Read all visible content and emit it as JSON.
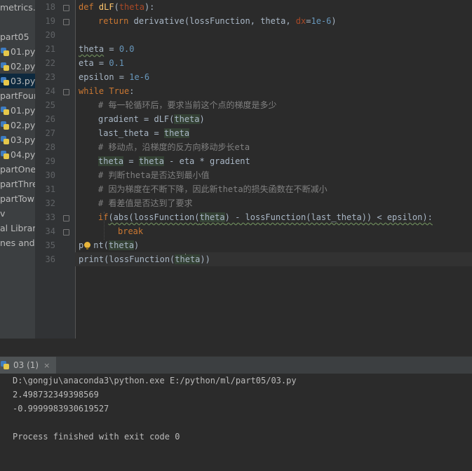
{
  "project_tree": {
    "items": [
      {
        "label": "metrics.p",
        "icon": "none"
      },
      {
        "label": "part05",
        "icon": "none"
      },
      {
        "label": "01.py",
        "icon": "python-file-icon"
      },
      {
        "label": "02.py",
        "icon": "python-file-icon"
      },
      {
        "label": "03.py",
        "icon": "python-file-icon",
        "selected": true
      },
      {
        "label": "partFour",
        "icon": "none"
      },
      {
        "label": "01.py",
        "icon": "python-file-icon"
      },
      {
        "label": "02.py",
        "icon": "python-file-icon"
      },
      {
        "label": "03.py",
        "icon": "python-file-icon"
      },
      {
        "label": "04.py",
        "icon": "python-file-icon"
      },
      {
        "label": "partOne",
        "icon": "none"
      },
      {
        "label": "partThree",
        "icon": "none"
      },
      {
        "label": "partTow",
        "icon": "none"
      },
      {
        "label": "v",
        "icon": "none"
      },
      {
        "label": "al Librari",
        "icon": "none"
      },
      {
        "label": "nes and C",
        "icon": "none"
      }
    ]
  },
  "editor": {
    "line_numbers": [
      "18",
      "19",
      "20",
      "21",
      "22",
      "23",
      "24",
      "25",
      "26",
      "27",
      "28",
      "29",
      "30",
      "31",
      "32",
      "33",
      "34",
      "35",
      "36"
    ],
    "current_line": "36",
    "code": {
      "l18": "def dLF(theta):",
      "l19_ret": "return",
      "l19_call": "derivative(lossFunction, theta, ",
      "l19_dx": "dx",
      "l19_eq": "=",
      "l19_val": "1e-6",
      "l19_end": ")",
      "l21_var": "theta",
      "l21_rest": " = ",
      "l21_val": "0.0",
      "l22_var": "eta = ",
      "l22_val": "0.1",
      "l23_var": "epsilon = ",
      "l23_val": "1e-6",
      "l24_kw": "while",
      "l24_true": "True",
      "l24_colon": ":",
      "l25": "# 每一轮循环后，要求当前这个点的梯度是多少",
      "l26_a": "gradient = dLF(",
      "l26_b": "theta",
      "l26_c": ")",
      "l27_a": "last_theta = ",
      "l27_b": "theta",
      "l28": "# 移动点，沿梯度的反方向移动步长eta",
      "l29_a": "theta",
      "l29_b": " = ",
      "l29_c": "theta",
      "l29_d": " - eta * gradient",
      "l30": "# 判断theta是否达到最小值",
      "l31": "# 因为梯度在不断下降，因此新theta的损失函数在不断减小",
      "l32": "# 看差值是否达到了要求",
      "l33_if": "if",
      "l33_a": "(abs(lossFunction(",
      "l33_b": "theta",
      "l33_c": ") - lossFunction(last_theta)) < epsilon):",
      "l34": "break",
      "l35_a": "p",
      "l35_b": "nt(",
      "l35_c": "theta",
      "l35_d": ")",
      "l36_a": "print(lossFunction(",
      "l36_b1": "th",
      "l36_b2": "eta",
      "l36_c": "))"
    }
  },
  "run_panel": {
    "tab_label": "03 (1)",
    "close_glyph": "×",
    "output_lines": [
      "D:\\gongju\\anaconda3\\python.exe E:/python/ml/part05/03.py",
      "2.498732349398569",
      "-0.9999983930619527",
      "",
      "Process finished with exit code 0"
    ]
  },
  "colors": {
    "background": "#2b2b2b",
    "keyword": "#cc7832",
    "function": "#ffc66d",
    "number": "#6897bb",
    "comment": "#808080",
    "selected_tree_row": "#0d293e"
  }
}
